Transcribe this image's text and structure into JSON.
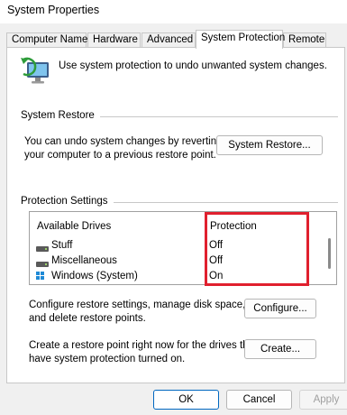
{
  "window": {
    "title": "System Properties"
  },
  "tabs": [
    {
      "label": "Computer Name"
    },
    {
      "label": "Hardware"
    },
    {
      "label": "Advanced"
    },
    {
      "label": "System Protection",
      "active": true
    },
    {
      "label": "Remote"
    }
  ],
  "intro": {
    "text": "Use system protection to undo unwanted system changes.",
    "icon": "computer-restore-icon"
  },
  "system_restore": {
    "heading": "System Restore",
    "description_line1": "You can undo system changes by reverting",
    "description_line2": "your computer to a previous restore point.",
    "button": "System Restore..."
  },
  "protection_settings": {
    "heading": "Protection Settings",
    "columns": {
      "drives": "Available Drives",
      "protection": "Protection"
    },
    "drives": [
      {
        "name": "Stuff",
        "protection": "Off",
        "icon": "drive-icon"
      },
      {
        "name": "Miscellaneous",
        "protection": "Off",
        "icon": "drive-icon"
      },
      {
        "name": "Windows (System)",
        "protection": "On",
        "icon": "windows-drive-icon"
      }
    ],
    "highlight_color": "#e0202e"
  },
  "configure": {
    "description_line1": "Configure restore settings, manage disk space,",
    "description_line2": "and delete restore points.",
    "button": "Configure..."
  },
  "create": {
    "description_line1": "Create a restore point right now for the drives that",
    "description_line2": "have system protection turned on.",
    "button": "Create..."
  },
  "footer": {
    "ok": "OK",
    "cancel": "Cancel",
    "apply": "Apply"
  },
  "colors": {
    "accent": "#0067c0",
    "window_bg": "#f0f0f0"
  }
}
